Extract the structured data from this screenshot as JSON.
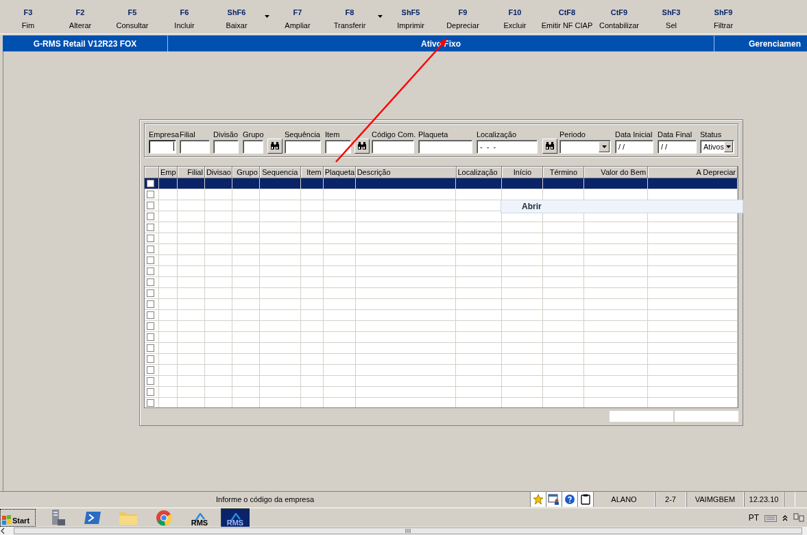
{
  "toolbar": [
    {
      "key": "F3",
      "label": "Fim",
      "dropdown": false
    },
    {
      "key": "F2",
      "label": "Alterar",
      "dropdown": false
    },
    {
      "key": "F5",
      "label": "Consultar",
      "dropdown": false
    },
    {
      "key": "F6",
      "label": "Incluir",
      "dropdown": false
    },
    {
      "key": "ShF6",
      "label": "Baixar",
      "dropdown": true
    },
    {
      "key": "F7",
      "label": "Ampliar",
      "dropdown": false
    },
    {
      "key": "F8",
      "label": "Transferir",
      "dropdown": true
    },
    {
      "key": "ShF5",
      "label": "Imprimir",
      "dropdown": false
    },
    {
      "key": "F9",
      "label": "Depreciar",
      "dropdown": false
    },
    {
      "key": "F10",
      "label": "Excluir",
      "dropdown": false
    },
    {
      "key": "CtF8",
      "label": "Emitir NF CIAP",
      "dropdown": false
    },
    {
      "key": "CtF9",
      "label": "Contabilizar",
      "dropdown": false
    },
    {
      "key": "ShF3",
      "label": "Sel",
      "dropdown": false
    },
    {
      "key": "ShF9",
      "label": "Filtrar",
      "dropdown": false
    }
  ],
  "title_bar": {
    "app": "G-RMS Retail V12R23 FOX",
    "screen": "Ativo Fixo",
    "module": "Gerenciamen"
  },
  "filters": [
    {
      "kind": "text",
      "label": "Empresa",
      "focused": true
    },
    {
      "kind": "text",
      "label": "Filial",
      "focused": false
    },
    {
      "kind": "text",
      "label": "Divisão",
      "focused": false
    },
    {
      "kind": "text",
      "label": "Grupo",
      "focused": false
    },
    {
      "kind": "search"
    },
    {
      "kind": "text",
      "label": "Sequência",
      "focused": false
    },
    {
      "kind": "text",
      "label": "Item",
      "focused": false
    },
    {
      "kind": "search"
    },
    {
      "kind": "text",
      "label": "Código Com.",
      "focused": false
    },
    {
      "kind": "text",
      "label": "Plaqueta",
      "focused": false
    },
    {
      "kind": "text",
      "label": "Localização",
      "value": "-  -  -",
      "focused": false
    },
    {
      "kind": "search"
    },
    {
      "kind": "combo",
      "label": "Periodo",
      "focused": false
    },
    {
      "kind": "text",
      "label": "Data Inicial",
      "value": "/ /",
      "focused": false
    },
    {
      "kind": "text",
      "label": "Data Final",
      "value": "/ /",
      "focused": false
    },
    {
      "kind": "combo",
      "label": "Status",
      "value": "Ativos",
      "focused": false
    }
  ],
  "table": {
    "columns": [
      "Emp",
      "Filial",
      "Divisao",
      "Grupo",
      "Sequencia",
      "Item",
      "Plaqueta",
      "Descrição",
      "Localização",
      "Início",
      "Término",
      "Valor do Bem",
      "A Depreciar"
    ],
    "rows": [
      {
        "checked": false,
        "selected": true
      },
      {
        "checked": false,
        "selected": false
      },
      {
        "checked": false,
        "selected": false
      },
      {
        "checked": false,
        "selected": false
      },
      {
        "checked": false,
        "selected": false
      },
      {
        "checked": false,
        "selected": false
      },
      {
        "checked": false,
        "selected": false
      },
      {
        "checked": false,
        "selected": false
      },
      {
        "checked": false,
        "selected": false
      },
      {
        "checked": false,
        "selected": false
      },
      {
        "checked": false,
        "selected": false
      },
      {
        "checked": false,
        "selected": false
      },
      {
        "checked": false,
        "selected": false
      },
      {
        "checked": false,
        "selected": false
      },
      {
        "checked": false,
        "selected": false
      },
      {
        "checked": false,
        "selected": false
      },
      {
        "checked": false,
        "selected": false
      },
      {
        "checked": false,
        "selected": false
      },
      {
        "checked": false,
        "selected": false
      },
      {
        "checked": false,
        "selected": false
      },
      {
        "checked": false,
        "selected": false
      }
    ]
  },
  "context_menu": {
    "items": [
      {
        "label": "Abrir"
      }
    ]
  },
  "status_bar": {
    "message": "Informe o código da empresa",
    "cells": [
      "ALANO",
      "2-7",
      "VAIMGBEM",
      "12.23.10"
    ]
  },
  "taskbar": {
    "start": "Start",
    "apps": [
      {
        "kind": "server",
        "selected": false
      },
      {
        "kind": "shell",
        "selected": false
      },
      {
        "kind": "folder",
        "selected": false
      },
      {
        "kind": "browser",
        "selected": false
      },
      {
        "kind": "rms",
        "label": "RMS",
        "selected": false
      },
      {
        "kind": "rms",
        "label": "RMS",
        "selected": true
      }
    ],
    "language": "PT"
  }
}
